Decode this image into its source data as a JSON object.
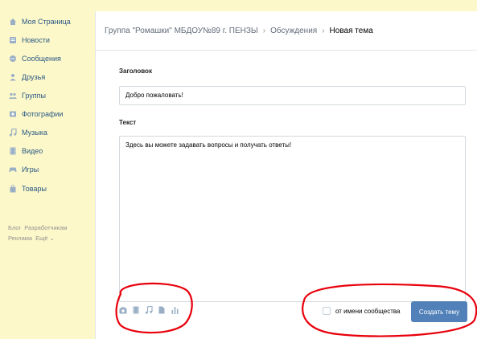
{
  "colors": {
    "page_bg": "#fcf8c9",
    "link": "#2a5885",
    "icon": "#9aafc5",
    "accent": "#5181b8",
    "annotation": "#e8000b"
  },
  "sidebar": {
    "items": [
      {
        "label": "Моя Страница",
        "icon": "home-icon"
      },
      {
        "label": "Новости",
        "icon": "news-icon"
      },
      {
        "label": "Сообщения",
        "icon": "messages-icon"
      },
      {
        "label": "Друзья",
        "icon": "friends-icon"
      },
      {
        "label": "Группы",
        "icon": "groups-icon"
      },
      {
        "label": "Фотографии",
        "icon": "camera-icon"
      },
      {
        "label": "Музыка",
        "icon": "music-icon"
      },
      {
        "label": "Видео",
        "icon": "video-icon"
      },
      {
        "label": "Игры",
        "icon": "games-icon"
      },
      {
        "label": "Товары",
        "icon": "goods-icon"
      }
    ],
    "footer_links": [
      {
        "label": "Блог"
      },
      {
        "label": "Разработчикам"
      },
      {
        "label": "Реклама"
      },
      {
        "label": "Ещё ⌄"
      }
    ]
  },
  "header": {
    "crumbs": [
      {
        "label": "Группа \"Ромашки\" МБДОУ№89 г. ПЕНЗЫ"
      },
      {
        "label": "Обсуждения"
      }
    ],
    "separator": "›",
    "current": "Новая тема"
  },
  "form": {
    "title_label": "Заголовок",
    "title_value": "Добро пожаловать!",
    "text_label": "Текст",
    "text_value": "Здесь вы можете задавать вопросы и получать ответы!",
    "attach_icons": [
      "camera-icon",
      "video-icon",
      "music-icon",
      "document-icon",
      "poll-icon"
    ],
    "as_community_label": "от имени сообщества",
    "submit_label": "Создать тему"
  }
}
